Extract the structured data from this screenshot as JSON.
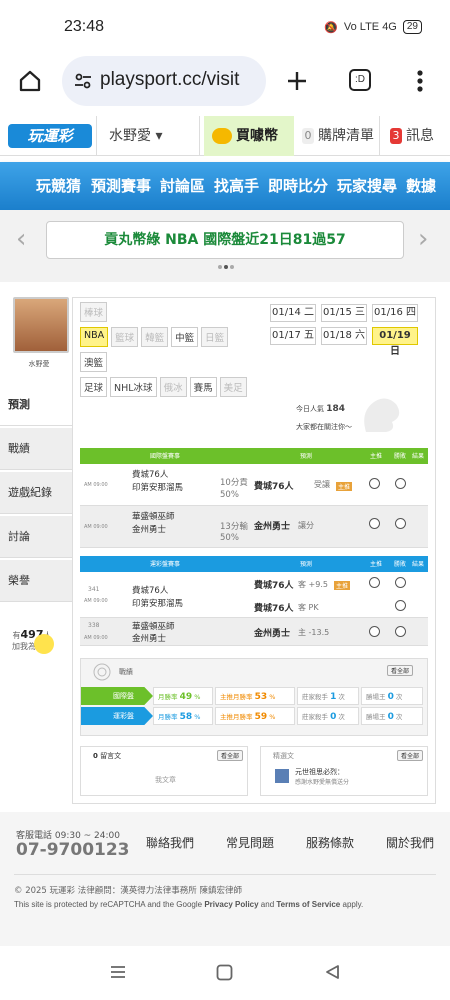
{
  "status": {
    "time": "23:48",
    "battery": "29",
    "net": "Vo LTE 4G"
  },
  "browser": {
    "url": "playsport.cc/visit",
    "tab_count": ":D"
  },
  "site": {
    "logo": "玩運彩",
    "user": "水野愛",
    "buy_coins": "買噱幣",
    "cart_count": "0",
    "cart": "購牌清單",
    "msg_count": "3",
    "messages": "訊息",
    "menu": [
      "玩競猜",
      "預測賽事",
      "討論區",
      "找高手",
      "即時比分",
      "玩家搜尋",
      "數據"
    ],
    "ticker": "貢丸幣綠 NBA 國際盤近21日81過57"
  },
  "profile": {
    "name": "水野愛",
    "tabs": [
      "預測",
      "戰績",
      "遊戲紀錄",
      "討論",
      "榮譽"
    ],
    "followers_prefix": "有",
    "followers": "497",
    "followers_suffix": "人",
    "followers_line2": "加我為好友"
  },
  "sports": [
    [
      "棒球"
    ],
    [
      "NBA",
      "籃球",
      "韓籃",
      "中籃",
      "日籃"
    ],
    [
      "澳籃"
    ],
    [
      "足球",
      "NHL冰球",
      "俄冰",
      "賽馬",
      "美足"
    ]
  ],
  "dates": [
    "01/14 二",
    "01/15 三",
    "01/16 四",
    "01/17 五",
    "01/18 六",
    "01/19 日"
  ],
  "popularity": {
    "label": "今日人氣",
    "value": "184",
    "note": "大家都在關注你～"
  },
  "intl": {
    "headers": [
      "國際盤賽事",
      "預測",
      "主推",
      "勝敗",
      "結果"
    ],
    "rows": [
      {
        "time": "AM 09:00",
        "teams": [
          "費城76人",
          "印第安那溜馬"
        ],
        "line": [
          "10分貢",
          "50%"
        ],
        "pick": "費城76人",
        "pick_note": "受讓",
        "tag": "主推"
      },
      {
        "time": "AM 09:00",
        "teams": [
          "華盛頓巫師",
          "金州勇士"
        ],
        "line": [
          "13分輸",
          "50%"
        ],
        "pick": "金州勇士",
        "pick_note": "讓分",
        "tag": ""
      }
    ]
  },
  "tw": {
    "headers": [
      "運彩盤賽事",
      "預測",
      "主推",
      "勝敗",
      "結果"
    ],
    "rows": [
      {
        "no": "341",
        "time": "AM 09:00",
        "teams": [
          "費城76人",
          "印第安那溜馬"
        ],
        "picks": [
          {
            "team": "費城76人",
            "note": "客 +9.5",
            "tag": "主推"
          },
          {
            "team": "費城76人",
            "note": "客 PK",
            "tag": ""
          }
        ]
      },
      {
        "no": "338",
        "time": "AM 09:00",
        "teams": [
          "華盛頓巫師",
          "金州勇士"
        ],
        "picks": [
          {
            "team": "金州勇士",
            "note": "主 -13.5",
            "tag": ""
          }
        ]
      }
    ]
  },
  "stats": {
    "title": "戰績",
    "btn": "看全部",
    "rows": [
      {
        "label": "國際盤",
        "color": "#6cc02a",
        "cells": [
          "月勝率",
          "49",
          "%",
          "主推月勝率",
          "53",
          "%",
          "莊家殺手",
          "1",
          "次",
          "勝場王",
          "0",
          "次"
        ]
      },
      {
        "label": "運彩盤",
        "color": "#1b9be0",
        "cells": [
          "月勝率",
          "58",
          "%",
          "主推月勝率",
          "59",
          "%",
          "莊家殺手",
          "0",
          "次",
          "勝場王",
          "0",
          "次"
        ]
      }
    ]
  },
  "wall": {
    "count": "0",
    "label": "留言文",
    "btn": "看全部",
    "empty": "我文章"
  },
  "recent": {
    "label": "精選文",
    "btn": "看全部",
    "item_title": "元世祖思必烈：",
    "item_sub": "感謝水野愛無償送分"
  },
  "footer": {
    "hotline_label": "客服電話 09:30 ~ 24:00",
    "hotline": "07-9700123",
    "links": [
      "聯絡我們",
      "常見問題",
      "服務條款",
      "關於我們"
    ],
    "copyright": "© 2025 玩運彩 法律顧問：漢英得力法律事務所 陳鎮宏律師",
    "recaptcha_pre": "This site is protected by reCAPTCHA and the Google ",
    "privacy": "Privacy Policy",
    "and": " and ",
    "terms": "Terms of Service",
    "apply": " apply."
  }
}
